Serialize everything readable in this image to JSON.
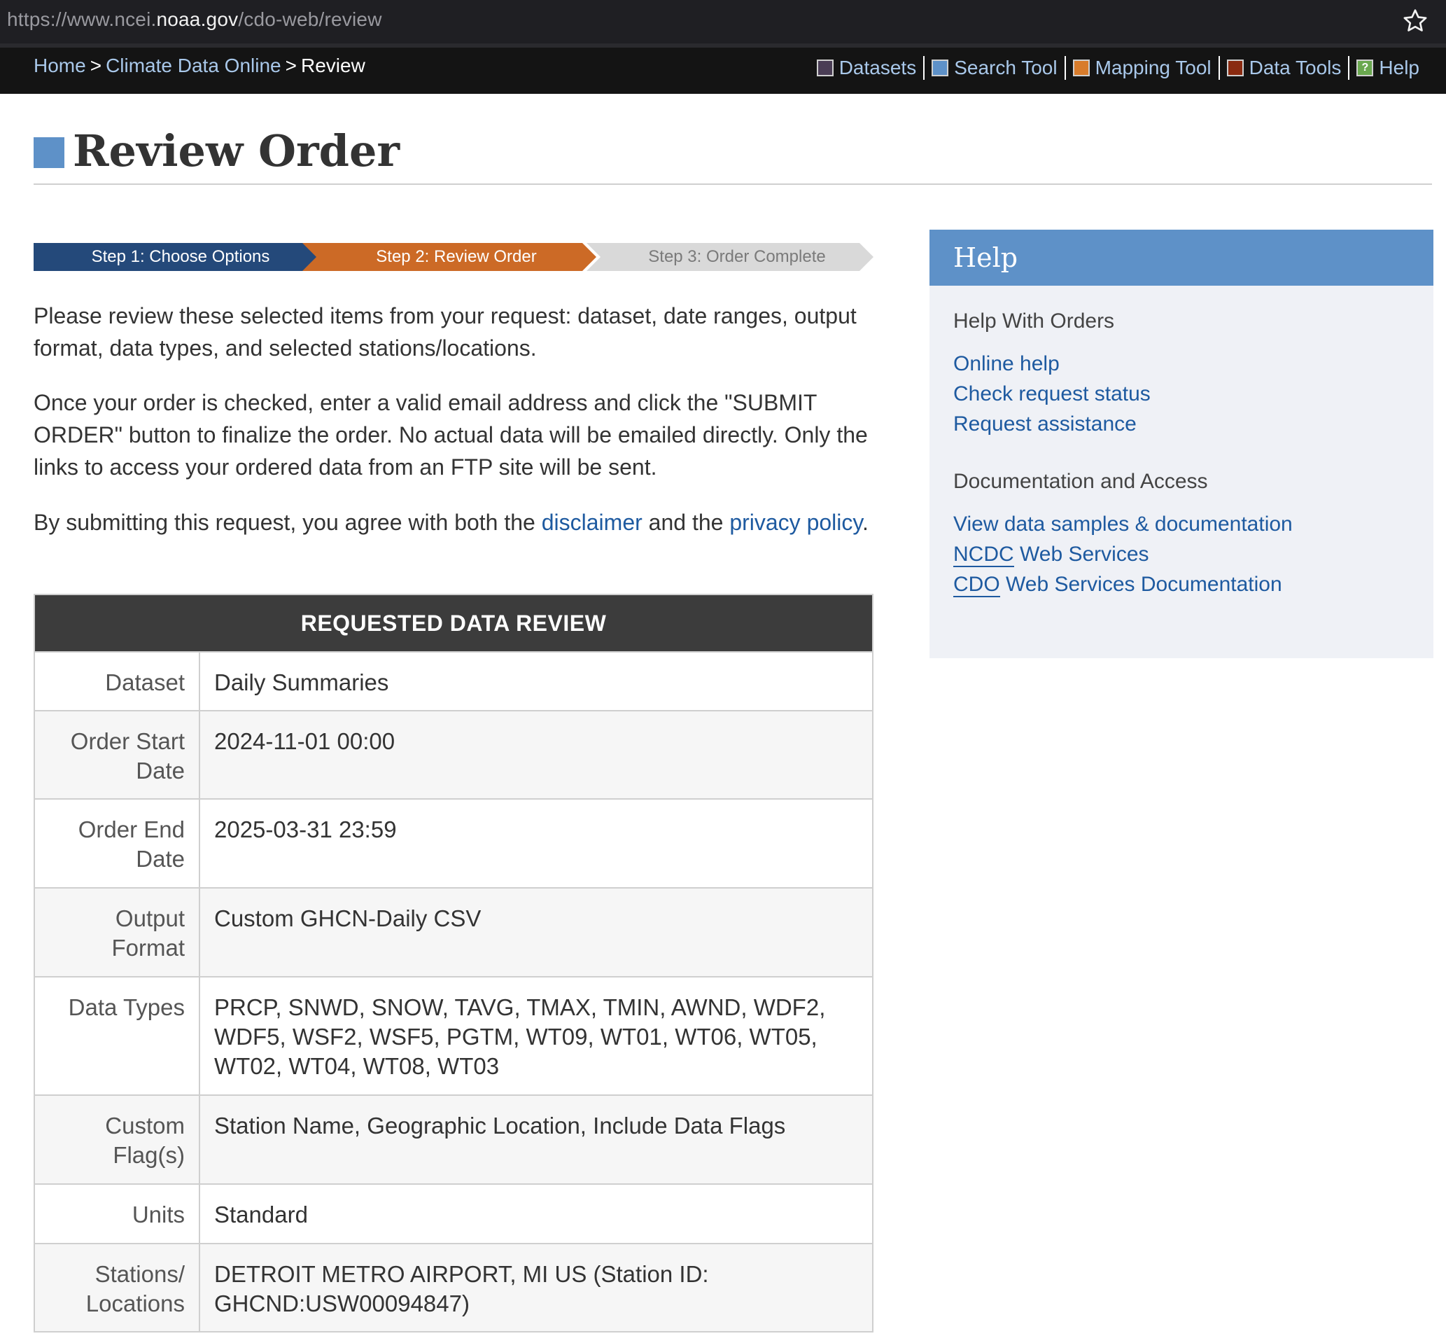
{
  "browser": {
    "url_prefix": "https://www.ncei.",
    "url_host": "noaa.gov",
    "url_path": "/cdo-web/review",
    "bookmark_icon": "star-outline-icon"
  },
  "nav": {
    "breadcrumb": [
      "Home",
      "Climate Data Online",
      "Review"
    ],
    "links": [
      {
        "label": "Datasets",
        "color": "#4a3d55"
      },
      {
        "label": "Search Tool",
        "color": "#5e91c8"
      },
      {
        "label": "Mapping Tool",
        "color": "#d87c2c"
      },
      {
        "label": "Data Tools",
        "color": "#8a2a10"
      },
      {
        "label": "Help",
        "color": "#6aa84f",
        "icon": "?"
      }
    ]
  },
  "page": {
    "title": "Review Order",
    "steps": [
      "Step 1: Choose Options",
      "Step 2: Review Order",
      "Step 3: Order Complete"
    ],
    "para1": "Please review these selected items from your request: dataset, date ranges, output format, data types, and selected stations/locations.",
    "para2": "Once your order is checked, enter a valid email address and click the \"SUBMIT ORDER\" button to finalize the order. No actual data will be emailed directly. Only the links to access your ordered data from an FTP site will be sent.",
    "para3_before": "By submitting this request, you agree with both the ",
    "para3_link1": "disclaimer",
    "para3_mid": " and the ",
    "para3_link2": "privacy policy",
    "para3_after": "."
  },
  "review_table": {
    "header": "REQUESTED DATA REVIEW",
    "rows": [
      {
        "label": "Dataset",
        "value": "Daily Summaries"
      },
      {
        "label": "Order Start Date",
        "value": "2024-11-01 00:00"
      },
      {
        "label": "Order End Date",
        "value": "2025-03-31 23:59"
      },
      {
        "label": "Output Format",
        "value": "Custom GHCN-Daily CSV"
      },
      {
        "label": "Data Types",
        "value": "PRCP, SNWD, SNOW, TAVG, TMAX, TMIN, AWND, WDF2, WDF5, WSF2, WSF5, PGTM, WT09, WT01, WT06, WT05, WT02, WT04, WT08, WT03"
      },
      {
        "label": "Custom Flag(s)",
        "value": "Station Name, Geographic Location, Include Data Flags"
      },
      {
        "label": "Units",
        "value": "Standard"
      },
      {
        "label": "Stations/ Locations",
        "value": "DETROIT METRO AIRPORT, MI US (Station ID: GHCND:USW00094847)"
      }
    ]
  },
  "help": {
    "title": "Help",
    "section1": "Help With Orders",
    "links1": [
      "Online help",
      "Check request status",
      "Request assistance"
    ],
    "section2": "Documentation and Access",
    "links2_0": "View data samples & documentation",
    "ncdc_abbr": "NCDC",
    "ncdc_rest": " Web Services",
    "cdo_abbr": "CDO",
    "cdo_rest": " Web Services Documentation"
  }
}
